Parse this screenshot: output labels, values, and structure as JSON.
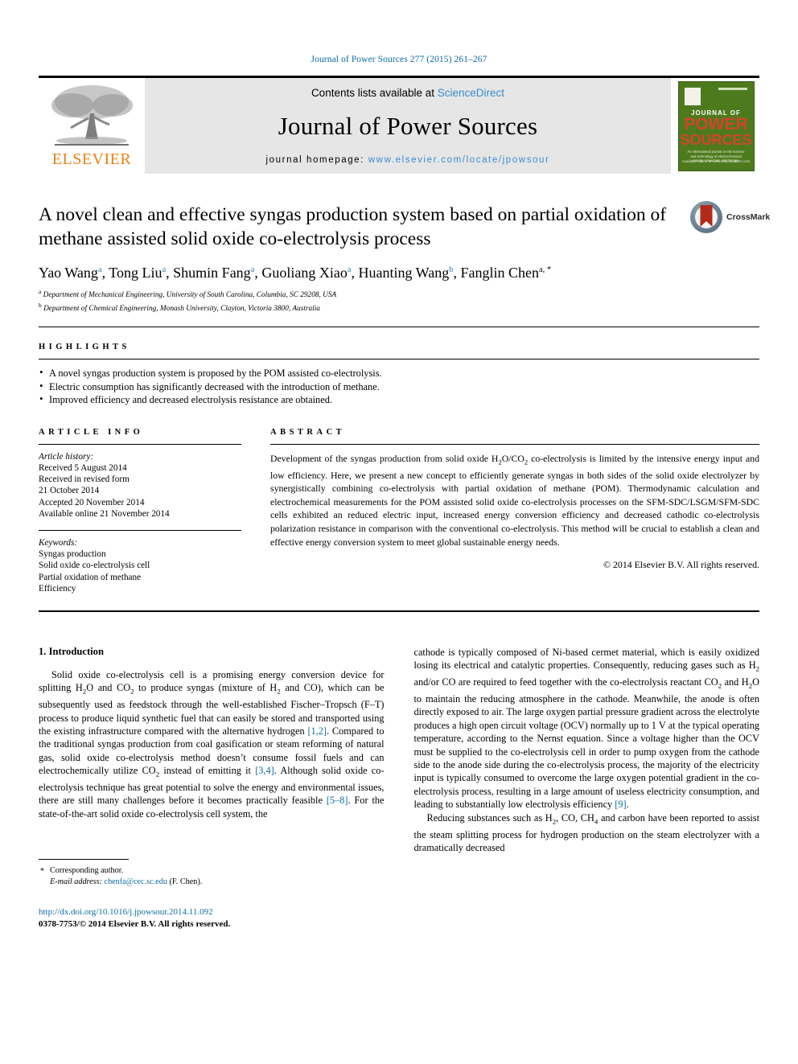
{
  "running_head": "Journal of Power Sources 277 (2015) 261–267",
  "masthead": {
    "publisher_name": "ELSEVIER",
    "contents_prefix": "Contents lists available at ",
    "contents_link": "ScienceDirect",
    "journal_title": "Journal of Power Sources",
    "homepage_label": "journal homepage:",
    "homepage_url": "www.elsevier.com/locate/jpowsour",
    "cover": {
      "line1": "JOURNAL OF",
      "line2": "POWER",
      "line3": "SOURCES",
      "blurb": "An international journal on the science and technology of electrochemical energy conversion and storage",
      "footer": "Available online at www.sciencedirect.com"
    }
  },
  "article": {
    "title": "A novel clean and effective syngas production system based on partial oxidation of methane assisted solid oxide co-electrolysis process",
    "authors": [
      {
        "name": "Yao Wang",
        "marks": "a"
      },
      {
        "name": "Tong Liu",
        "marks": "a"
      },
      {
        "name": "Shumin Fang",
        "marks": "a"
      },
      {
        "name": "Guoliang Xiao",
        "marks": "a"
      },
      {
        "name": "Huanting Wang",
        "marks": "b"
      },
      {
        "name": "Fanglin Chen",
        "marks": "a, *"
      }
    ],
    "affiliations": [
      {
        "mark": "a",
        "text": "Department of Mechanical Engineering, University of South Carolina, Columbia, SC 29208, USA"
      },
      {
        "mark": "b",
        "text": "Department of Chemical Engineering, Monash University, Clayton, Victoria 3800, Australia"
      }
    ],
    "crossmark_label": "CrossMark"
  },
  "highlights": {
    "heading": "HIGHLIGHTS",
    "items": [
      "A novel syngas production system is proposed by the POM assisted co-electrolysis.",
      "Electric consumption has significantly decreased with the introduction of methane.",
      "Improved efficiency and decreased electrolysis resistance are obtained."
    ]
  },
  "article_info": {
    "heading": "ARTICLE INFO",
    "history_label": "Article history:",
    "history": [
      "Received 5 August 2014",
      "Received in revised form",
      "21 October 2014",
      "Accepted 20 November 2014",
      "Available online 21 November 2014"
    ],
    "keywords_label": "Keywords:",
    "keywords": [
      "Syngas production",
      "Solid oxide co-electrolysis cell",
      "Partial oxidation of methane",
      "Efficiency"
    ]
  },
  "abstract": {
    "heading": "ABSTRACT",
    "text_part1": "Development of the syngas production from solid oxide H",
    "text_sub1": "2",
    "text_part2": "O/CO",
    "text_sub2": "2",
    "text_part3": " co-electrolysis is limited by the intensive energy input and low efficiency. Here, we present a new concept to efficiently generate syngas in both sides of the solid oxide electrolyzer by synergistically combining co-electrolysis with partial oxidation of methane (POM). Thermodynamic calculation and electrochemical measurements for the POM assisted solid oxide co-electrolysis processes on the SFM-SDC/LSGM/SFM-SDC cells exhibited an reduced electric input, increased energy conversion efficiency and decreased cathodic co-electrolysis polarization resistance in comparison with the conventional co-electrolysis. This method will be crucial to establish a clean and effective energy conversion system to meet global sustainable energy needs.",
    "copyright": "© 2014 Elsevier B.V. All rights reserved."
  },
  "body": {
    "section_heading": "1. Introduction",
    "left_paragraph_1a": "Solid oxide co-electrolysis cell is a promising energy conversion device for splitting H",
    "left_p1_sub1": "2",
    "left_p1_b": "O and CO",
    "left_p1_sub2": "2",
    "left_p1_c": " to produce syngas (mixture of H",
    "left_p1_sub3": "2",
    "left_p1_d": " and CO), which can be subsequently used as feedstock through the well-established Fischer–Tropsch (F–T) process to produce liquid synthetic fuel that can easily be stored and transported using the existing infrastructure compared with the alternative hydrogen ",
    "left_p1_ref1": "[1,2]",
    "left_p1_e": ". Compared to the traditional syngas production from coal gasification or steam reforming of natural gas, solid oxide co-electrolysis method doesn’t consume fossil fuels and can electrochemically utilize CO",
    "left_p1_sub4": "2",
    "left_p1_f": " instead of emitting it ",
    "left_p1_ref2": "[3,4]",
    "left_p1_g": ". Although solid oxide co-electrolysis technique has great potential to solve the energy and environmental issues, there are still many challenges before it becomes practically feasible ",
    "left_p1_ref3": "[5–8]",
    "left_p1_h": ". For the state-of-the-art solid oxide co-electrolysis cell system, the",
    "right_p1_a": "cathode is typically composed of Ni-based cermet material, which is easily oxidized losing its electrical and catalytic properties. Consequently, reducing gases such as H",
    "right_p1_sub1": "2",
    "right_p1_b": " and/or CO are required to feed together with the co-electrolysis reactant CO",
    "right_p1_sub2": "2",
    "right_p1_c": " and H",
    "right_p1_sub3": "2",
    "right_p1_d": "O to maintain the reducing atmosphere in the cathode. Meanwhile, the anode is often directly exposed to air. The large oxygen partial pressure gradient across the electrolyte produces a high open circuit voltage (OCV) normally up to 1 V at the typical operating temperature, according to the Nernst equation. Since a voltage higher than the OCV must be supplied to the co-electrolysis cell in order to pump oxygen from the cathode side to the anode side during the co-electrolysis process, the majority of the electricity input is typically consumed to overcome the large oxygen potential gradient in the co-electrolysis process, resulting in a large amount of useless electricity consumption, and leading to substantially low electrolysis efficiency ",
    "right_p1_ref1": "[9]",
    "right_p1_e": ".",
    "right_p2_a": "Reducing substances such as H",
    "right_p2_sub1": "2",
    "right_p2_b": ", CO, CH",
    "right_p2_sub2": "4",
    "right_p2_c": " and carbon have been reported to assist the steam splitting process for hydrogen production on the steam electrolyzer with a dramatically decreased"
  },
  "footer": {
    "corresponding_label": "Corresponding author.",
    "email_label": "E-mail address:",
    "email": "chenfa@cec.sc.edu",
    "email_suffix": "(F. Chen).",
    "doi": "http://dx.doi.org/10.1016/j.jpowsour.2014.11.092",
    "issn_line_a": "0378-7753/",
    "issn_line_b": "© 2014 Elsevier B.V. All rights reserved."
  },
  "colors": {
    "link_blue": "#0d6ca3",
    "sd_blue": "#3a8bd0",
    "elsevier_orange": "#ec8013",
    "cover_green": "#4e7a1e",
    "cover_red": "#d2442a"
  }
}
